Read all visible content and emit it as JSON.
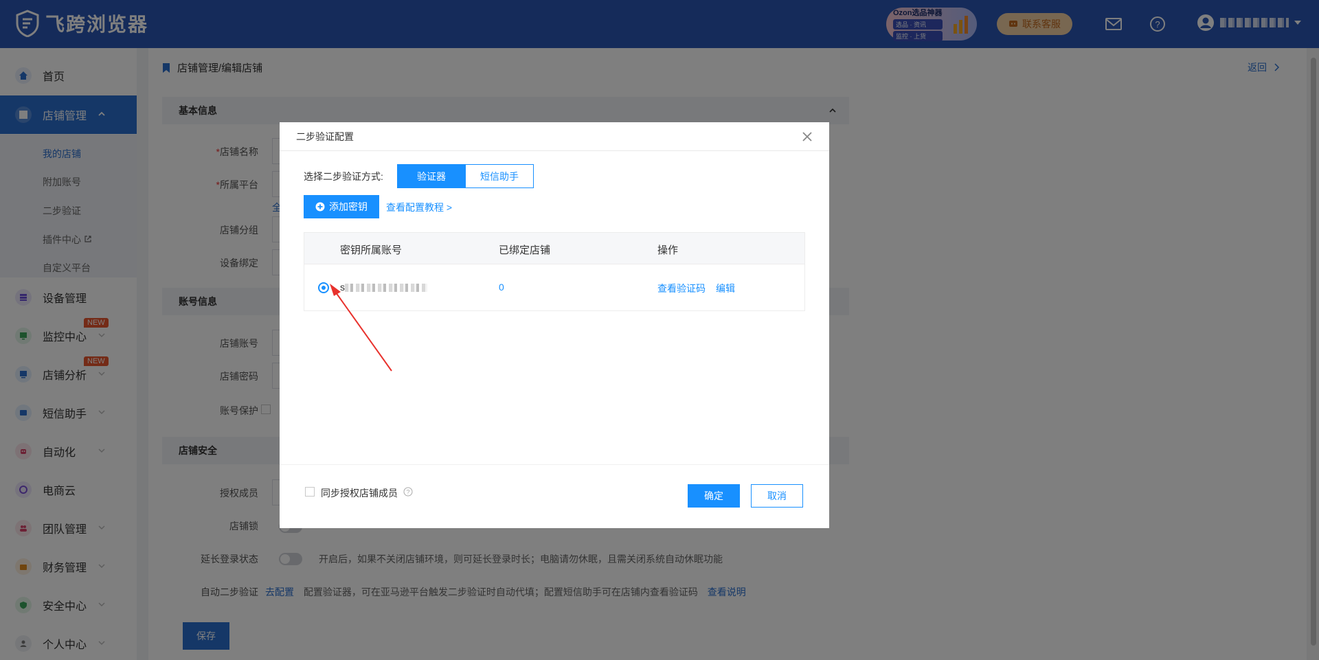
{
  "header": {
    "brand": "飞跨浏览器",
    "ozon_ad": {
      "title": "Ozon选品神器",
      "line1": "选品 · 资讯",
      "line2": "监控 · 上货"
    },
    "support_label": "联系客服"
  },
  "sidebar": {
    "items": [
      {
        "label": "首页",
        "icon": "home-icon"
      },
      {
        "label": "店铺管理",
        "icon": "store-icon"
      },
      {
        "label": "设备管理",
        "icon": "device-icon"
      },
      {
        "label": "监控中心",
        "icon": "monitor-icon",
        "badge": "NEW"
      },
      {
        "label": "店铺分析",
        "icon": "analytics-icon",
        "badge": "NEW"
      },
      {
        "label": "短信助手",
        "icon": "sms-icon"
      },
      {
        "label": "自动化",
        "icon": "robot-icon"
      },
      {
        "label": "电商云",
        "icon": "cloud-icon"
      },
      {
        "label": "团队管理",
        "icon": "team-icon"
      },
      {
        "label": "财务管理",
        "icon": "wallet-icon"
      },
      {
        "label": "安全中心",
        "icon": "shield-icon"
      },
      {
        "label": "个人中心",
        "icon": "user-icon"
      }
    ],
    "sub_items": [
      "我的店铺",
      "附加账号",
      "二步验证",
      "插件中心",
      "自定义平台"
    ]
  },
  "main": {
    "breadcrumb": "店铺管理/编辑店铺",
    "back": "返回",
    "sections": {
      "basic": "基本信息",
      "account": "账号信息",
      "security": "店铺安全"
    },
    "labels": {
      "store_name": "店铺名称",
      "platform": "所属平台",
      "group": "店铺分组",
      "device": "设备绑定",
      "store_account": "店铺账号",
      "store_password": "店铺密码",
      "account_protect": "账号保护",
      "auth_members": "授权成员",
      "store_lock": "店铺锁",
      "extend_login": "延长登录状态",
      "auto_2fa": "自动二步验证"
    },
    "required_mark": "*",
    "platform_hint": "全",
    "extend_login_desc": "开启后，如果不关闭店铺环境，则可延长登录时长；电脑请勿休眠，且需关闭系统自动休眠功能",
    "auto_2fa_link": "去配置",
    "auto_2fa_desc": "配置验证器，可在亚马逊平台触发二步验证时自动代填；配置短信助手可在店铺内查看验证码",
    "auto_2fa_more": "查看说明",
    "save": "保存"
  },
  "modal": {
    "title": "二步验证配置",
    "method_label": "选择二步验证方式:",
    "method_options": [
      "验证器",
      "短信助手"
    ],
    "method_selected": "验证器",
    "add_key": "添加密钥",
    "tutorial": "查看配置教程 >",
    "table": {
      "headers": [
        "密钥所属账号",
        "已绑定店铺",
        "操作"
      ],
      "rows": [
        {
          "account_prefix": "s",
          "bound_stores": "0",
          "actions": [
            "查看验证码",
            "编辑"
          ],
          "selected": true
        }
      ]
    },
    "sync_label": "同步授权店铺成员",
    "confirm": "确定",
    "cancel": "取消"
  },
  "colors": {
    "header_blue": "#2b57b5",
    "primary": "#1890ff",
    "sidebar_active": "#2b6fcf",
    "badge": "#e8562f",
    "annotation_arrow": "#e8322d"
  }
}
